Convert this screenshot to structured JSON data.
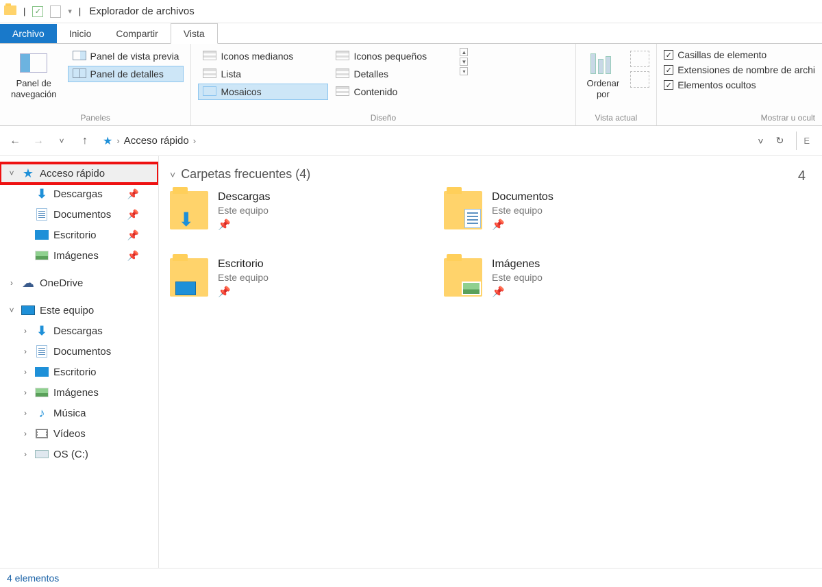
{
  "title_bar": {
    "app_title": "Explorador de archivos",
    "separator": "|",
    "dropdown_caret": "▾"
  },
  "tabs": {
    "file": "Archivo",
    "home": "Inicio",
    "share": "Compartir",
    "view": "Vista"
  },
  "ribbon": {
    "panels_group": {
      "nav_panel": "Panel de\nnavegación",
      "dropdown_caret": "▾",
      "preview_pane": "Panel de vista previa",
      "details_pane": "Panel de detalles",
      "label": "Paneles"
    },
    "layout_group": {
      "medium_icons": "Iconos medianos",
      "small_icons": "Iconos pequeños",
      "list": "Lista",
      "details": "Detalles",
      "tiles": "Mosaicos",
      "content": "Contenido",
      "label": "Diseño"
    },
    "current_view_group": {
      "sort_by": "Ordenar\npor",
      "dropdown_caret": "▾",
      "label": "Vista actual"
    },
    "showhide_group": {
      "item_checkboxes": "Casillas de elemento",
      "filename_ext": "Extensiones de nombre de archi",
      "hidden_items": "Elementos ocultos",
      "label": "Mostrar u ocult"
    }
  },
  "nav": {
    "breadcrumb_root": "Acceso rápido",
    "chevron": "›",
    "dropdown_caret": "˅",
    "refresh": "↻",
    "search_cut": "E"
  },
  "tree": {
    "quick_access": "Acceso rápido",
    "downloads": "Descargas",
    "documents": "Documentos",
    "desktop": "Escritorio",
    "pictures": "Imágenes",
    "onedrive": "OneDrive",
    "this_pc": "Este equipo",
    "pc_downloads": "Descargas",
    "pc_documents": "Documentos",
    "pc_desktop": "Escritorio",
    "pc_pictures": "Imágenes",
    "pc_music": "Música",
    "pc_videos": "Vídeos",
    "pc_os": "OS (C:)"
  },
  "content": {
    "section_title": "Carpetas frecuentes (4)",
    "count_right": "4",
    "folders": [
      {
        "name": "Descargas",
        "sub": "Este equipo"
      },
      {
        "name": "Documentos",
        "sub": "Este equipo"
      },
      {
        "name": "Escritorio",
        "sub": "Este equipo"
      },
      {
        "name": "Imágenes",
        "sub": "Este equipo"
      }
    ]
  },
  "status": {
    "text": "4 elementos"
  },
  "glyphs": {
    "check": "✓",
    "pin": "📌",
    "caret_down": "˅",
    "caret_right": "›",
    "folder_sys": "📁"
  }
}
